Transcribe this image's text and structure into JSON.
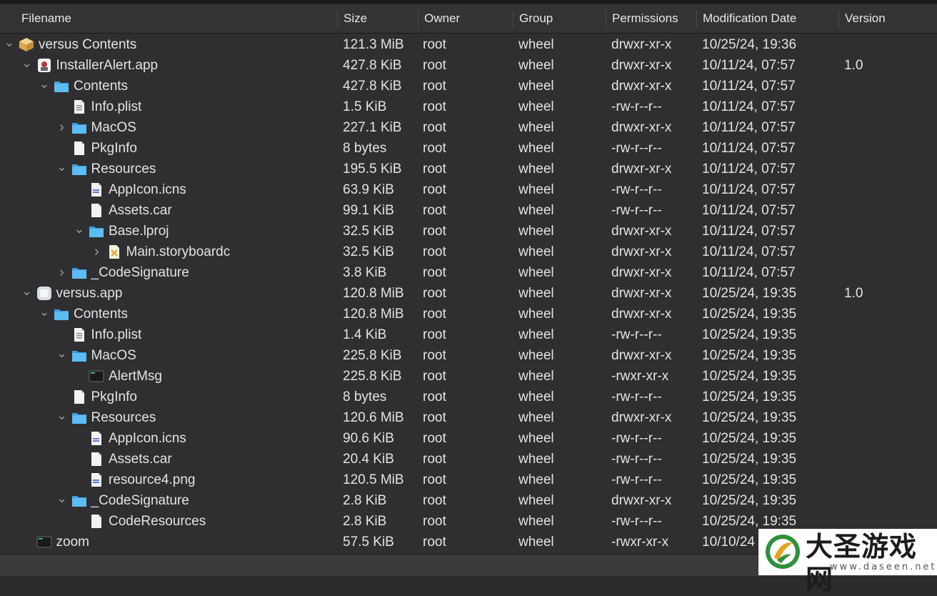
{
  "columns": {
    "filename": "Filename",
    "size": "Size",
    "owner": "Owner",
    "group": "Group",
    "permissions": "Permissions",
    "modification_date": "Modification Date",
    "version": "Version"
  },
  "rows": [
    {
      "name": "versus Contents",
      "size": "121.3 MiB",
      "owner": "root",
      "group": "wheel",
      "perm": "drwxr-xr-x",
      "date": "10/25/24, 19:36",
      "version": "",
      "level": 0,
      "chevron": "down",
      "icon": "package-icon"
    },
    {
      "name": "InstallerAlert.app",
      "size": "427.8 KiB",
      "owner": "root",
      "group": "wheel",
      "perm": "drwxr-xr-x",
      "date": "10/11/24, 07:57",
      "version": "1.0",
      "level": 1,
      "chevron": "down",
      "icon": "app-icon"
    },
    {
      "name": "Contents",
      "size": "427.8 KiB",
      "owner": "root",
      "group": "wheel",
      "perm": "drwxr-xr-x",
      "date": "10/11/24, 07:57",
      "version": "",
      "level": 2,
      "chevron": "down",
      "icon": "folder-icon"
    },
    {
      "name": "Info.plist",
      "size": "1.5 KiB",
      "owner": "root",
      "group": "wheel",
      "perm": "-rw-r--r--",
      "date": "10/11/24, 07:57",
      "version": "",
      "level": 3,
      "chevron": "",
      "icon": "plist-icon"
    },
    {
      "name": "MacOS",
      "size": "227.1 KiB",
      "owner": "root",
      "group": "wheel",
      "perm": "drwxr-xr-x",
      "date": "10/11/24, 07:57",
      "version": "",
      "level": 3,
      "chevron": "right",
      "icon": "folder-icon"
    },
    {
      "name": "PkgInfo",
      "size": "8 bytes",
      "owner": "root",
      "group": "wheel",
      "perm": "-rw-r--r--",
      "date": "10/11/24, 07:57",
      "version": "",
      "level": 3,
      "chevron": "",
      "icon": "document-icon"
    },
    {
      "name": "Resources",
      "size": "195.5 KiB",
      "owner": "root",
      "group": "wheel",
      "perm": "drwxr-xr-x",
      "date": "10/11/24, 07:57",
      "version": "",
      "level": 3,
      "chevron": "down",
      "icon": "folder-icon"
    },
    {
      "name": "AppIcon.icns",
      "size": "63.9 KiB",
      "owner": "root",
      "group": "wheel",
      "perm": "-rw-r--r--",
      "date": "10/11/24, 07:57",
      "version": "",
      "level": 4,
      "chevron": "",
      "icon": "image-file-icon"
    },
    {
      "name": "Assets.car",
      "size": "99.1 KiB",
      "owner": "root",
      "group": "wheel",
      "perm": "-rw-r--r--",
      "date": "10/11/24, 07:57",
      "version": "",
      "level": 4,
      "chevron": "",
      "icon": "document-icon"
    },
    {
      "name": "Base.lproj",
      "size": "32.5 KiB",
      "owner": "root",
      "group": "wheel",
      "perm": "drwxr-xr-x",
      "date": "10/11/24, 07:57",
      "version": "",
      "level": 4,
      "chevron": "down",
      "icon": "folder-icon"
    },
    {
      "name": "Main.storyboardc",
      "size": "32.5 KiB",
      "owner": "root",
      "group": "wheel",
      "perm": "drwxr-xr-x",
      "date": "10/11/24, 07:57",
      "version": "",
      "level": 5,
      "chevron": "right",
      "icon": "storyboard-icon"
    },
    {
      "name": "_CodeSignature",
      "size": "3.8 KiB",
      "owner": "root",
      "group": "wheel",
      "perm": "drwxr-xr-x",
      "date": "10/11/24, 07:57",
      "version": "",
      "level": 3,
      "chevron": "right",
      "icon": "folder-icon"
    },
    {
      "name": "versus.app",
      "size": "120.8 MiB",
      "owner": "root",
      "group": "wheel",
      "perm": "drwxr-xr-x",
      "date": "10/25/24, 19:35",
      "version": "1.0",
      "level": 1,
      "chevron": "down",
      "icon": "app-generic-icon"
    },
    {
      "name": "Contents",
      "size": "120.8 MiB",
      "owner": "root",
      "group": "wheel",
      "perm": "drwxr-xr-x",
      "date": "10/25/24, 19:35",
      "version": "",
      "level": 2,
      "chevron": "down",
      "icon": "folder-icon"
    },
    {
      "name": "Info.plist",
      "size": "1.4 KiB",
      "owner": "root",
      "group": "wheel",
      "perm": "-rw-r--r--",
      "date": "10/25/24, 19:35",
      "version": "",
      "level": 3,
      "chevron": "",
      "icon": "plist-icon"
    },
    {
      "name": "MacOS",
      "size": "225.8 KiB",
      "owner": "root",
      "group": "wheel",
      "perm": "drwxr-xr-x",
      "date": "10/25/24, 19:35",
      "version": "",
      "level": 3,
      "chevron": "down",
      "icon": "folder-icon"
    },
    {
      "name": "AlertMsg",
      "size": "225.8 KiB",
      "owner": "root",
      "group": "wheel",
      "perm": "-rwxr-xr-x",
      "date": "10/25/24, 19:35",
      "version": "",
      "level": 4,
      "chevron": "",
      "icon": "terminal-icon"
    },
    {
      "name": "PkgInfo",
      "size": "8 bytes",
      "owner": "root",
      "group": "wheel",
      "perm": "-rw-r--r--",
      "date": "10/25/24, 19:35",
      "version": "",
      "level": 3,
      "chevron": "",
      "icon": "document-icon"
    },
    {
      "name": "Resources",
      "size": "120.6 MiB",
      "owner": "root",
      "group": "wheel",
      "perm": "drwxr-xr-x",
      "date": "10/25/24, 19:35",
      "version": "",
      "level": 3,
      "chevron": "down",
      "icon": "folder-icon"
    },
    {
      "name": "AppIcon.icns",
      "size": "90.6 KiB",
      "owner": "root",
      "group": "wheel",
      "perm": "-rw-r--r--",
      "date": "10/25/24, 19:35",
      "version": "",
      "level": 4,
      "chevron": "",
      "icon": "image-file-icon"
    },
    {
      "name": "Assets.car",
      "size": "20.4 KiB",
      "owner": "root",
      "group": "wheel",
      "perm": "-rw-r--r--",
      "date": "10/25/24, 19:35",
      "version": "",
      "level": 4,
      "chevron": "",
      "icon": "document-icon"
    },
    {
      "name": "resource4.png",
      "size": "120.5 MiB",
      "owner": "root",
      "group": "wheel",
      "perm": "-rw-r--r--",
      "date": "10/25/24, 19:35",
      "version": "",
      "level": 4,
      "chevron": "",
      "icon": "image-file-icon"
    },
    {
      "name": "_CodeSignature",
      "size": "2.8 KiB",
      "owner": "root",
      "group": "wheel",
      "perm": "drwxr-xr-x",
      "date": "10/25/24, 19:35",
      "version": "",
      "level": 3,
      "chevron": "down",
      "icon": "folder-icon"
    },
    {
      "name": "CodeResources",
      "size": "2.8 KiB",
      "owner": "root",
      "group": "wheel",
      "perm": "-rw-r--r--",
      "date": "10/25/24, 19:35",
      "version": "",
      "level": 4,
      "chevron": "",
      "icon": "document-icon"
    },
    {
      "name": "zoom",
      "size": "57.5 KiB",
      "owner": "root",
      "group": "wheel",
      "perm": "-rwxr-xr-x",
      "date": "10/10/24",
      "version": "",
      "level": 1,
      "chevron": "",
      "icon": "terminal-icon"
    }
  ],
  "watermark": {
    "title": "大圣游戏网",
    "url": "www.daseen.net"
  },
  "colors": {
    "background": "#2f2f31",
    "header": "#333335",
    "text": "#e3e3e5",
    "folder": "#4fb3f0",
    "chevron": "#9a9a9e"
  }
}
